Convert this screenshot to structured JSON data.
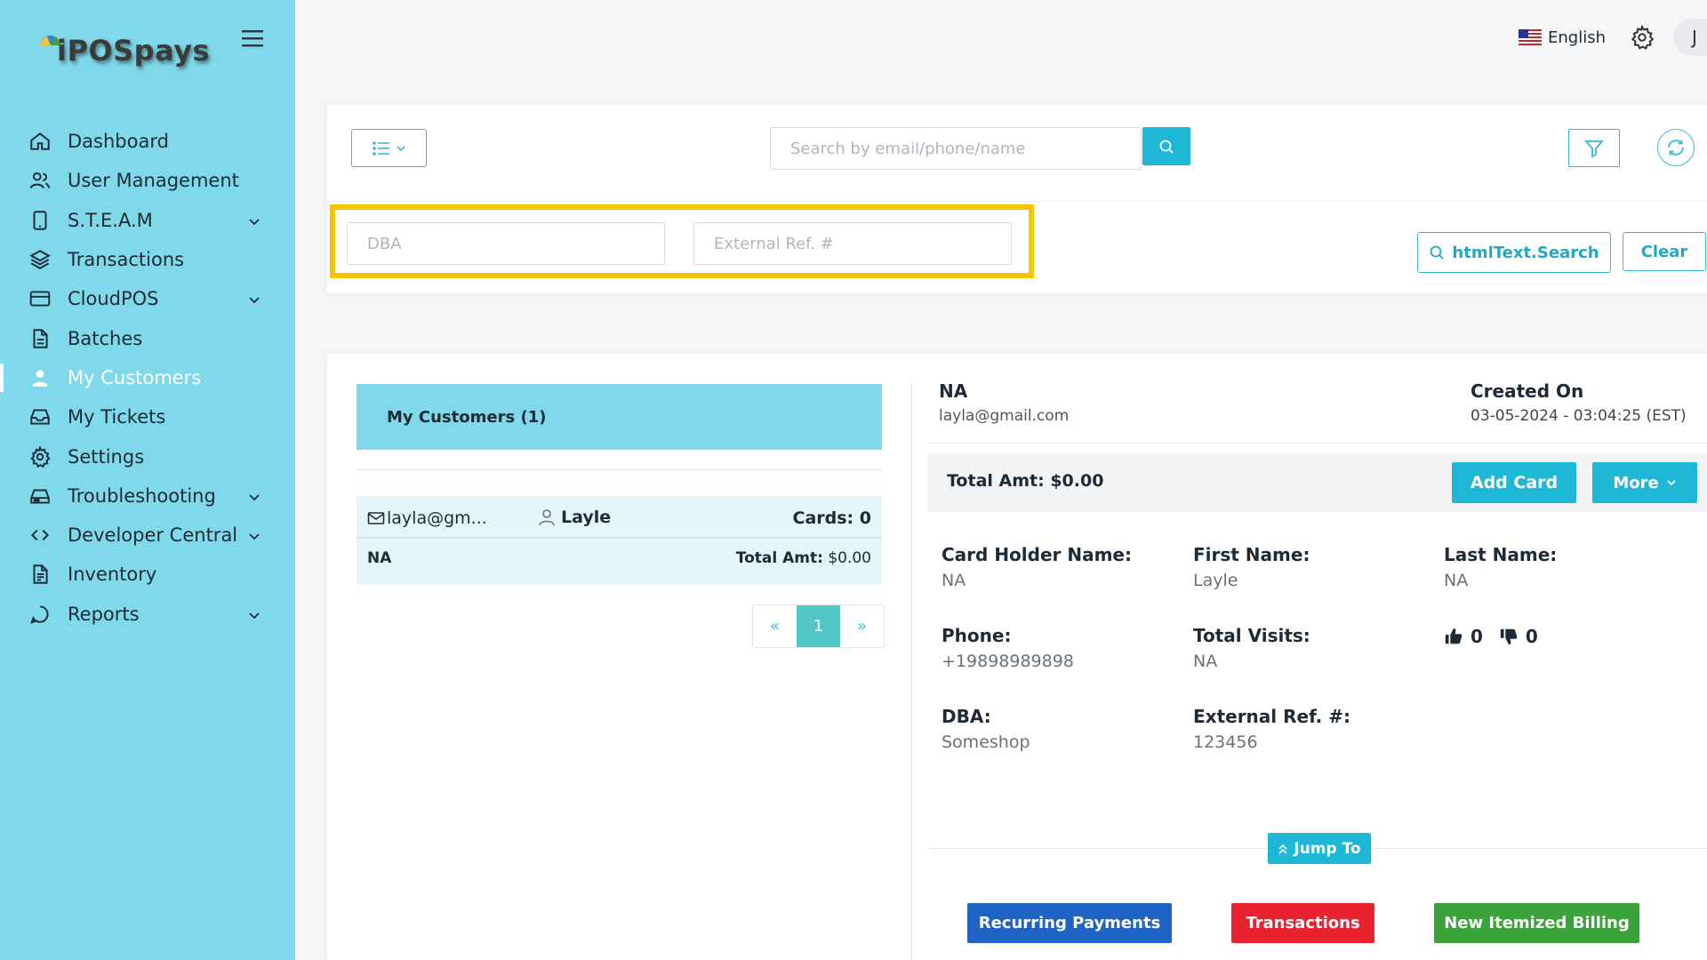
{
  "app": {
    "logo_text": "iPOSpays"
  },
  "sidebar": {
    "items": [
      {
        "label": "Dashboard",
        "icon": "home-icon"
      },
      {
        "label": "User Management",
        "icon": "users-icon"
      },
      {
        "label": "S.T.E.A.M",
        "icon": "device-icon",
        "expandable": true
      },
      {
        "label": "Transactions",
        "icon": "layers-icon"
      },
      {
        "label": "CloudPOS",
        "icon": "card-icon",
        "expandable": true
      },
      {
        "label": "Batches",
        "icon": "file-icon"
      },
      {
        "label": "My Customers",
        "icon": "user-icon",
        "active": true
      },
      {
        "label": "My Tickets",
        "icon": "inbox-icon"
      },
      {
        "label": "Settings",
        "icon": "gear-icon"
      },
      {
        "label": "Troubleshooting",
        "icon": "drive-icon",
        "expandable": true
      },
      {
        "label": "Developer Central",
        "icon": "code-icon",
        "expandable": true
      },
      {
        "label": "Inventory",
        "icon": "document-icon"
      },
      {
        "label": "Reports",
        "icon": "chat-icon",
        "expandable": true
      }
    ]
  },
  "topbar": {
    "language": "English",
    "avatar_initial": "J"
  },
  "search": {
    "placeholder": "Search by email/phone/name",
    "dba_placeholder": "DBA",
    "external_ref_placeholder": "External Ref. #",
    "search_button_label": "htmlText.Search",
    "clear_button_label": "Clear"
  },
  "customers_list": {
    "header": "My Customers (1)",
    "rows": [
      {
        "email": "layla@gm...",
        "name": "Layle",
        "cards": "Cards: 0",
        "dba": "NA",
        "total_label": "Total Amt:",
        "total_value": "$0.00"
      }
    ],
    "pagination": {
      "prev": "«",
      "current": "1",
      "next": "»"
    }
  },
  "detail": {
    "name": "NA",
    "email": "layla@gmail.com",
    "created_label": "Created On",
    "created_value": "03-05-2024 - 03:04:25 (EST)",
    "total_amt": "Total Amt: $0.00",
    "add_card_label": "Add Card",
    "more_label": "More",
    "fields": {
      "card_holder_label": "Card Holder Name:",
      "card_holder_value": "NA",
      "first_name_label": "First Name:",
      "first_name_value": "Layle",
      "last_name_label": "Last Name:",
      "last_name_value": "NA",
      "phone_label": "Phone:",
      "phone_value": "+19898989898",
      "total_visits_label": "Total Visits:",
      "total_visits_value": "NA",
      "dba_label": "DBA:",
      "dba_value": "Someshop",
      "external_ref_label": "External Ref. #:",
      "external_ref_value": "123456"
    },
    "votes": {
      "up": "0",
      "down": "0"
    },
    "jump_to_label": "Jump To",
    "actions": {
      "recurring": "Recurring Payments",
      "transactions": "Transactions",
      "itemized": "New Itemized Billing"
    }
  },
  "colors": {
    "sidebar_bg": "#7fd9ea",
    "accent": "#1fb7d6",
    "highlight": "#f7c400",
    "recurring": "#1f63c4",
    "transactions": "#e8222e",
    "itemized": "#3aa43a"
  }
}
